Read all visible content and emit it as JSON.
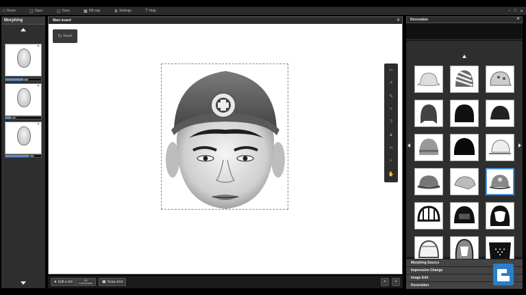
{
  "topbar": {
    "items": [
      {
        "icon": "home-icon",
        "label": "Home"
      },
      {
        "icon": "open-icon",
        "label": "Open"
      },
      {
        "icon": "save-icon",
        "label": "Save"
      },
      {
        "icon": "grid-icon",
        "label": "DB mgr"
      },
      {
        "icon": "gear-icon",
        "label": "Settings"
      },
      {
        "icon": "help-icon",
        "label": "Help"
      }
    ],
    "window_controls": [
      "–",
      "□",
      "✕"
    ]
  },
  "morphing": {
    "title": "Morphing",
    "items": [
      {
        "value": "50",
        "fill_fraction": 0.5
      },
      {
        "value": "17",
        "fill_fraction": 0.17
      },
      {
        "value": "75",
        "fill_fraction": 0.75
      }
    ]
  },
  "main_board": {
    "title": "Main board",
    "reset_label": "Reset",
    "tools": [
      "scissors-icon",
      "lines-icon",
      "pen-icon",
      "arrow-icon",
      "question-icon",
      "hat-icon",
      "glasses-icon",
      "search-icon",
      "hand-icon"
    ],
    "active_tool": "hat-icon"
  },
  "bottom_bar": {
    "edit_dot": "Edit a dot",
    "conversion_line1": "3D",
    "conversion_line2": "Conversion",
    "snapshot": "Snap shot"
  },
  "decoration": {
    "title": "Decoration",
    "items": [
      "bucket-hat",
      "striped-beanie",
      "patterned-cap",
      "ear-flap-hat",
      "black-ear-flap-hat",
      "black-beanie",
      "knit-beanie",
      "black-fur-hat",
      "white-cap",
      "baseball-cap",
      "tilted-cap",
      "cap-with-emblem",
      "bike-helmet",
      "black-helmet",
      "full-face-helmet",
      "white-helmet",
      "motocross-helmet",
      "face-mask"
    ],
    "selected_index": 11
  },
  "accordion": [
    "Morphing Source",
    "Impression Change",
    "Image Edit",
    "Decoration"
  ]
}
